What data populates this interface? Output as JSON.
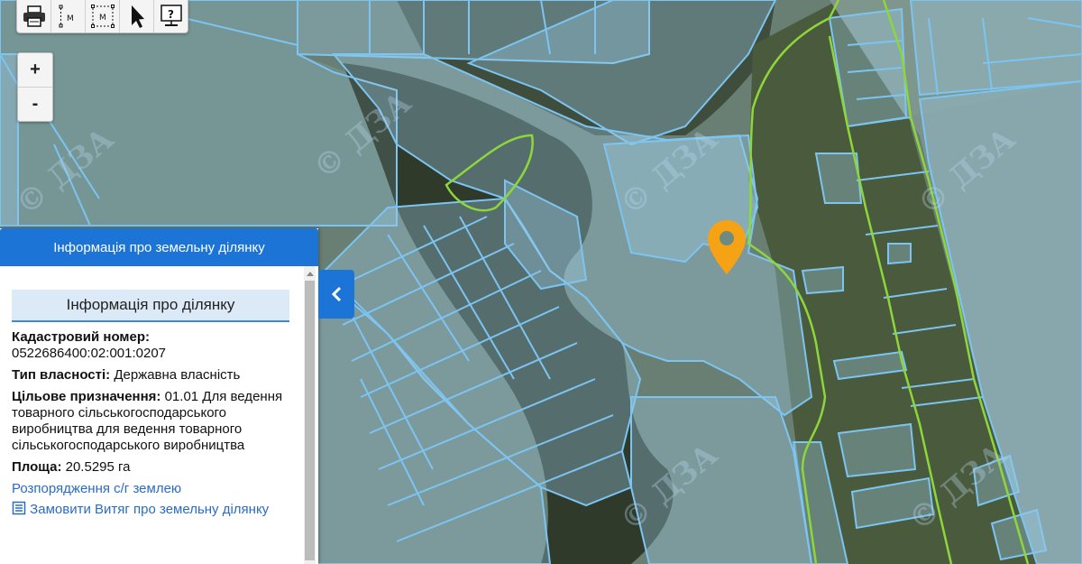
{
  "toolbar": {
    "tools": [
      {
        "name": "print-tool",
        "icon": "printer-icon",
        "label": ""
      },
      {
        "name": "measure-line-tool",
        "icon": "measure-line-icon",
        "label": "M"
      },
      {
        "name": "measure-area-tool",
        "icon": "measure-area-icon",
        "label": "M"
      },
      {
        "name": "select-tool",
        "icon": "cursor-icon",
        "label": ""
      },
      {
        "name": "help-tool",
        "icon": "help-screen-icon",
        "label": "?"
      }
    ]
  },
  "zoom": {
    "in_label": "+",
    "out_label": "-"
  },
  "map": {
    "watermark": "© ДЗА",
    "colors": {
      "parcel_line": "#7cc4f2",
      "parcel_fill": "#9ecfe8",
      "boundary_line": "#8dd63c",
      "marker": "#f5a214"
    }
  },
  "panel": {
    "header": "Інформація про земельну ділянку",
    "section_title": "Інформація про ділянку",
    "cadastral_label": "Кадастровий номер:",
    "cadastral_value": "0522686400:02:001:0207",
    "ownership_label": "Тип власності:",
    "ownership_value": "Державна власність",
    "purpose_label": "Цільове призначення:",
    "purpose_value": "01.01 Для ведення товарного сільськогосподарського виробництва для ведення товарного сільськогосподарського виробництва",
    "area_label": "Площа:",
    "area_value": "20.5295 га",
    "link_orders": "Розпорядження с/г землею",
    "link_extract": "Замовити Витяг про земельну ділянку"
  },
  "colors": {
    "accent": "#1c75d6",
    "section_bg": "#dce9f7",
    "link": "#2a6cc4"
  }
}
